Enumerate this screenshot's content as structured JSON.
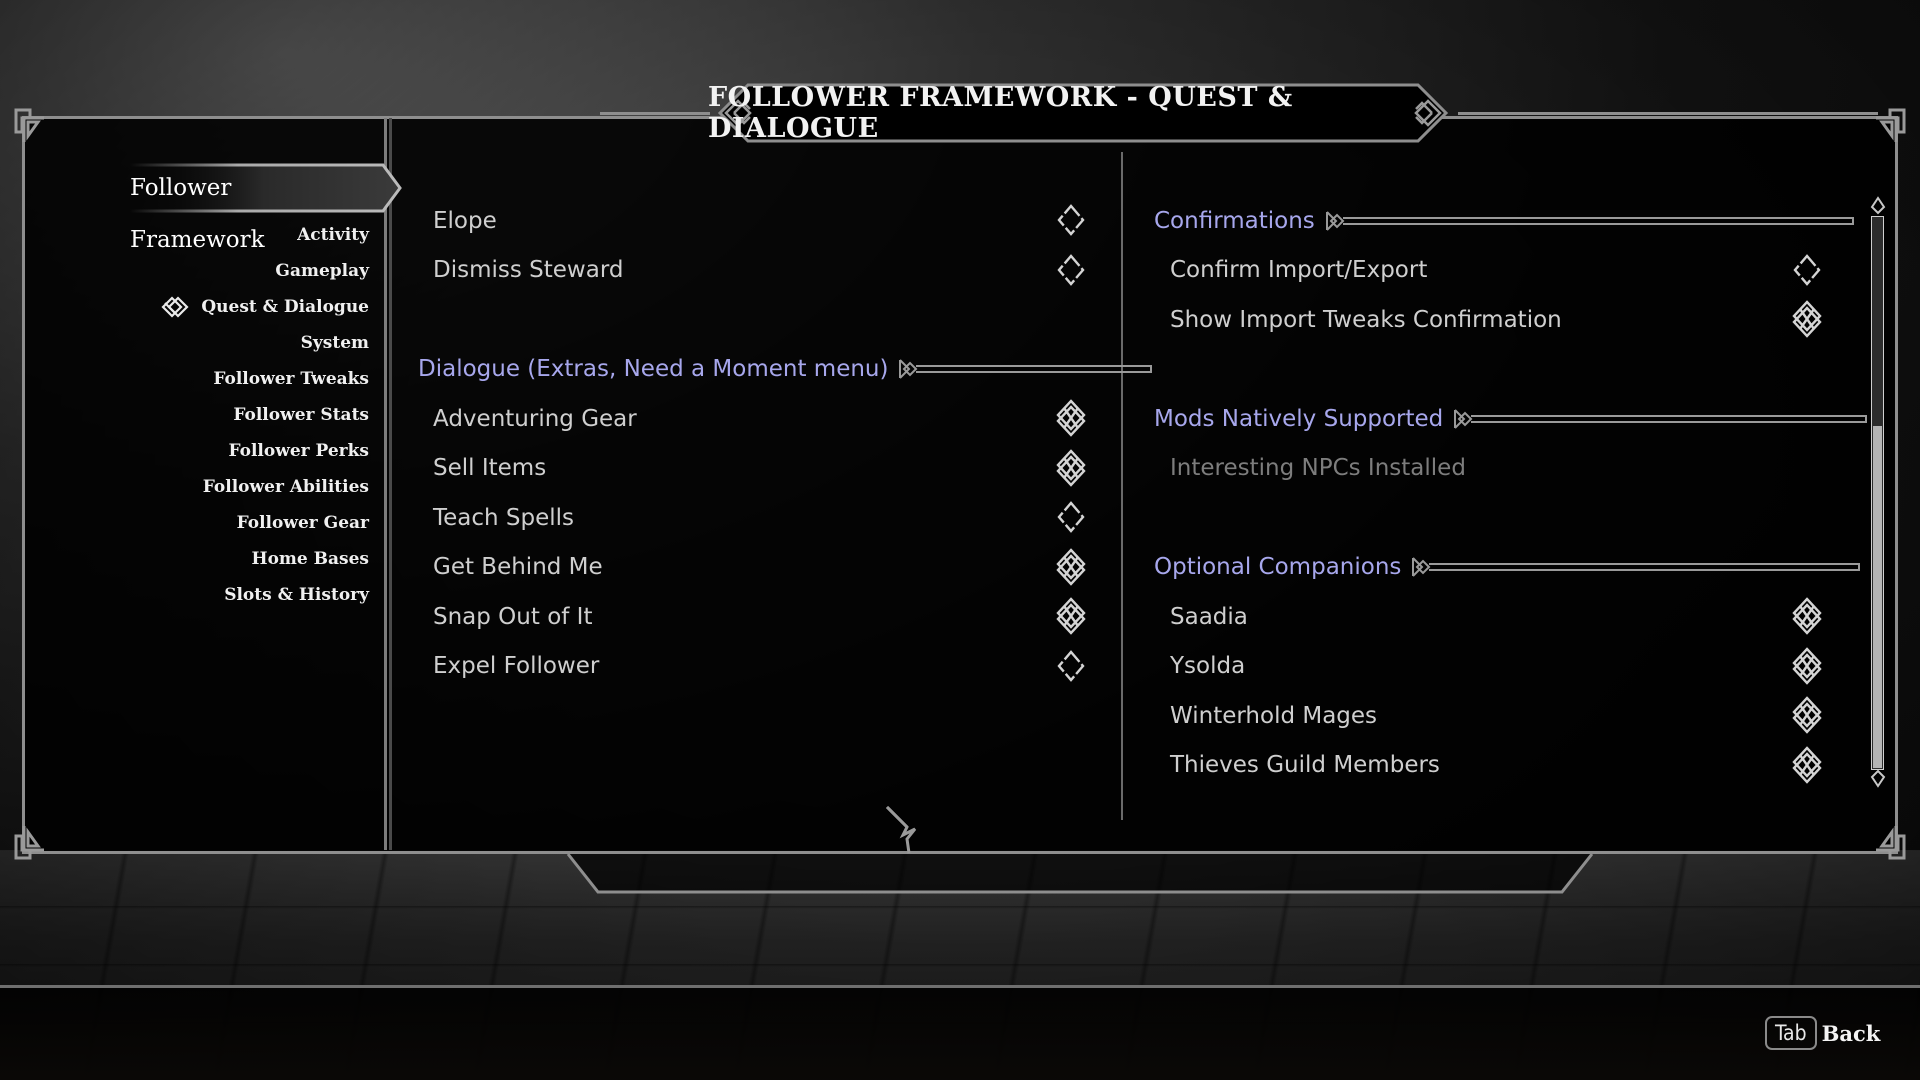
{
  "title": "FOLLOWER FRAMEWORK - QUEST & DIALOGUE",
  "sidebar": {
    "header": "Follower Framework",
    "items": [
      {
        "label": "Activity",
        "selected": false
      },
      {
        "label": "Gameplay",
        "selected": false
      },
      {
        "label": "Quest & Dialogue",
        "selected": true
      },
      {
        "label": "System",
        "selected": false
      },
      {
        "label": "Follower Tweaks",
        "selected": false
      },
      {
        "label": "Follower Stats",
        "selected": false
      },
      {
        "label": "Follower Perks",
        "selected": false
      },
      {
        "label": "Follower Abilities",
        "selected": false
      },
      {
        "label": "Follower Gear",
        "selected": false
      },
      {
        "label": "Home Bases",
        "selected": false
      },
      {
        "label": "Slots & History",
        "selected": false
      }
    ]
  },
  "left_column": {
    "top_items": [
      {
        "label": "Elope",
        "checked": false
      },
      {
        "label": "Dismiss Steward",
        "checked": false
      }
    ],
    "dialogue_section": {
      "header": "Dialogue (Extras, Need a Moment menu)",
      "items": [
        {
          "label": "Adventuring Gear",
          "checked": true
        },
        {
          "label": "Sell Items",
          "checked": true
        },
        {
          "label": "Teach Spells",
          "checked": false
        },
        {
          "label": "Get Behind Me",
          "checked": true
        },
        {
          "label": "Snap Out of It",
          "checked": true
        },
        {
          "label": "Expel Follower",
          "checked": false
        }
      ]
    }
  },
  "right_column": {
    "confirmations": {
      "header": "Confirmations",
      "items": [
        {
          "label": "Confirm Import/Export",
          "checked": false
        },
        {
          "label": "Show Import Tweaks Confirmation",
          "checked": true
        }
      ]
    },
    "mods_supported": {
      "header": "Mods Natively Supported",
      "items": [
        {
          "label": "Interesting NPCs Installed",
          "disabled": true
        }
      ]
    },
    "optional_companions": {
      "header": "Optional Companions",
      "items": [
        {
          "label": "Saadia",
          "checked": true
        },
        {
          "label": "Ysolda",
          "checked": true
        },
        {
          "label": "Winterhold Mages",
          "checked": true
        },
        {
          "label": "Thieves Guild Members",
          "checked": true
        }
      ]
    }
  },
  "scrollbar": {
    "position_fraction": 0.0,
    "visible_fraction": 0.62
  },
  "footer": {
    "key": "Tab",
    "action": "Back"
  },
  "colors": {
    "section_header": "#a7a7ec",
    "item_text": "#cfcfcf",
    "disabled_text": "#7d7d7d",
    "frame": "#8e8e8e"
  }
}
